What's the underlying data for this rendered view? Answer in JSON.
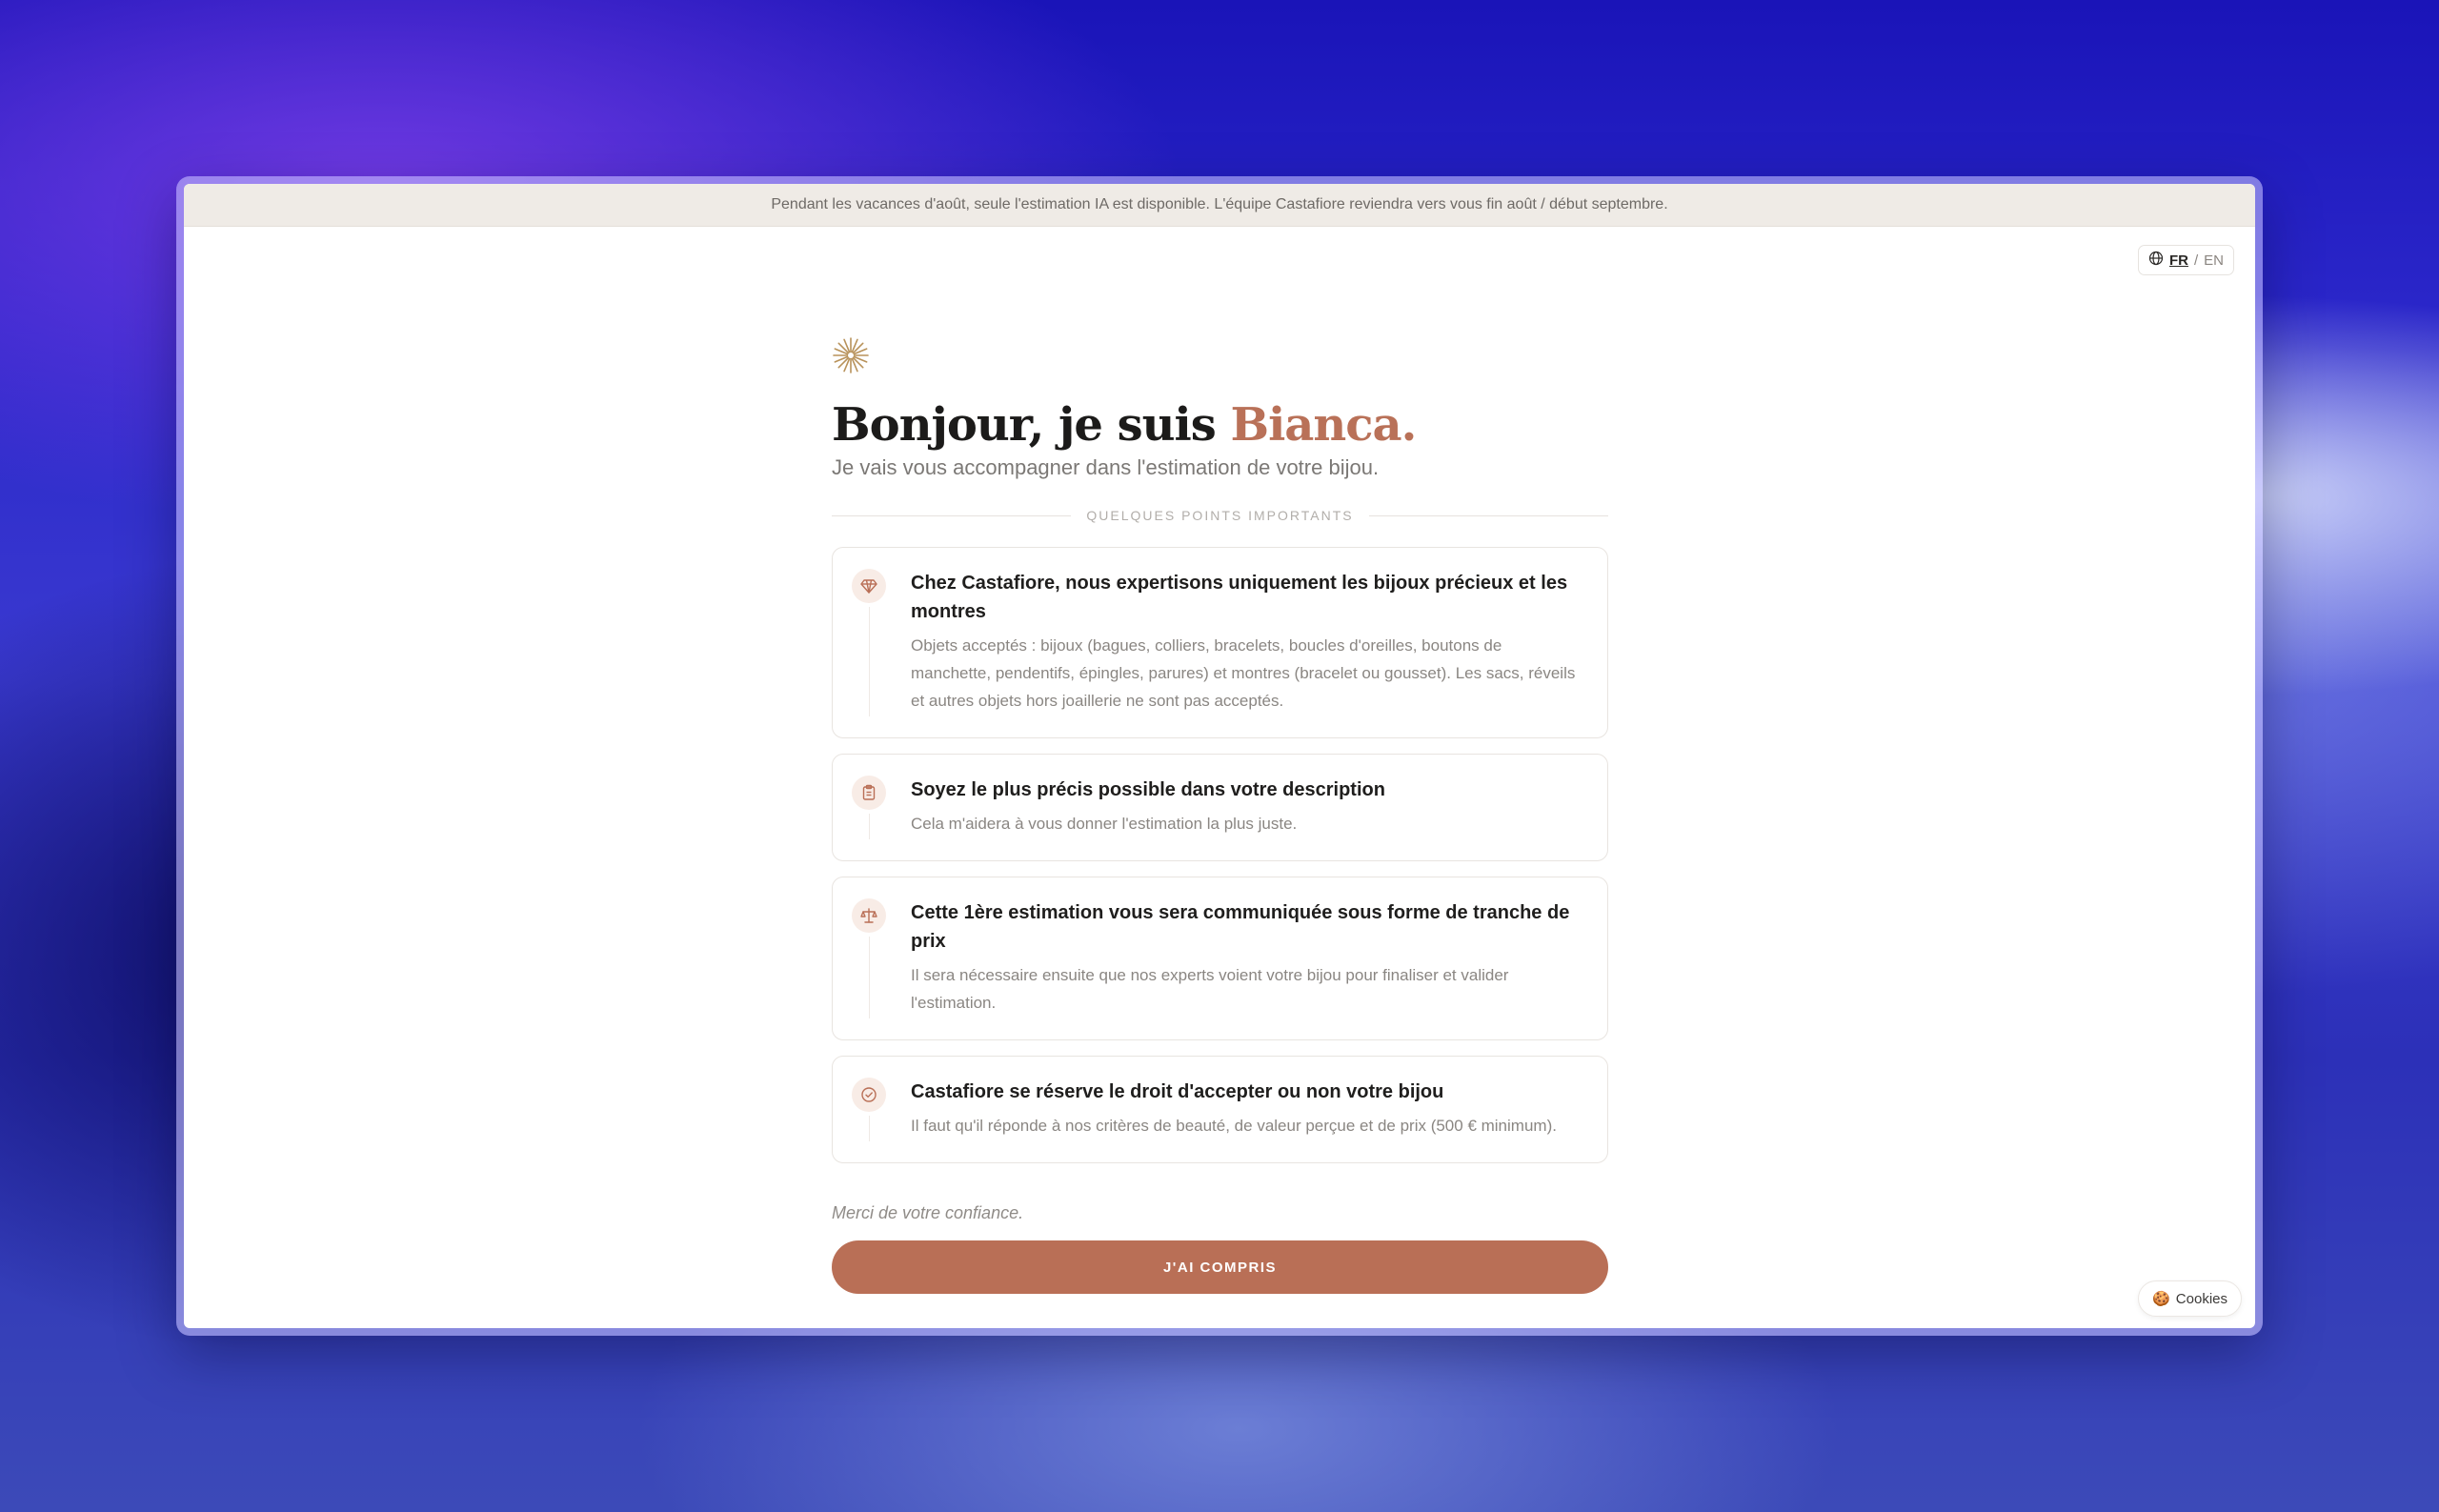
{
  "banner": {
    "text": "Pendant les vacances d'août, seule l'estimation IA est disponible. L'équipe Castafiore reviendra vers vous fin août / début septembre."
  },
  "lang": {
    "icon": "globe-icon",
    "fr": "FR",
    "separator": "/",
    "en": "EN"
  },
  "hero": {
    "logo_icon": "sunburst-logo",
    "title_prefix": "Bonjour, je suis ",
    "title_name": "Bianca.",
    "subtitle": "Je vais vous accompagner dans l'estimation de votre bijou."
  },
  "section_title": "QUELQUES POINTS IMPORTANTS",
  "cards": [
    {
      "icon": "diamond-icon",
      "title": "Chez Castafiore, nous expertisons uniquement les bijoux précieux et les montres",
      "text": "Objets acceptés : bijoux (bagues, colliers, bracelets, boucles d'oreilles, boutons de manchette, pendentifs, épingles, parures) et montres (bracelet ou gousset). Les sacs, réveils et autres objets hors joaillerie ne sont pas acceptés."
    },
    {
      "icon": "clipboard-icon",
      "title": "Soyez le plus précis possible dans votre description",
      "text": "Cela m'aidera à vous donner l'estimation la plus juste."
    },
    {
      "icon": "scale-icon",
      "title": "Cette 1ère estimation vous sera communiquée sous forme de tranche de prix",
      "text": "Il sera nécessaire ensuite que nos experts voient votre bijou pour finaliser et valider l'estimation."
    },
    {
      "icon": "check-circle-icon",
      "title": "Castafiore se réserve le droit d'accepter ou non votre bijou",
      "text": "Il faut qu'il réponde à nos critères de beauté, de valeur perçue et de prix (500 € minimum)."
    }
  ],
  "thanks": "Merci de votre confiance.",
  "cta_label": "J'AI COMPRIS",
  "cookies": {
    "icon": "cookie-icon",
    "label": "Cookies"
  },
  "colors": {
    "accent": "#b96f56",
    "banner_bg": "#efebe6",
    "icon_bg": "#f8ece6"
  }
}
